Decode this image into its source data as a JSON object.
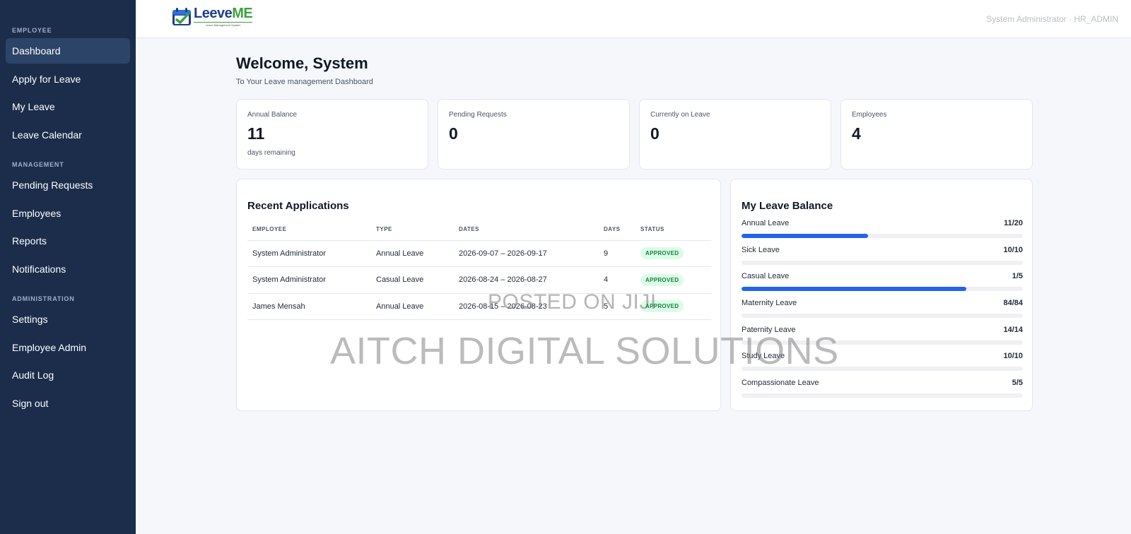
{
  "sidebar": {
    "sections": [
      {
        "title": "EMPLOYEE",
        "items": [
          "Dashboard",
          "Apply for Leave",
          "My Leave",
          "Leave Calendar"
        ]
      },
      {
        "title": "MANAGEMENT",
        "items": [
          "Pending Requests",
          "Employees",
          "Reports",
          "Notifications"
        ]
      },
      {
        "title": "ADMINISTRATION",
        "items": [
          "Settings",
          "Employee Admin",
          "Audit Log",
          "Sign out"
        ]
      }
    ],
    "active": "Dashboard"
  },
  "header": {
    "logo_part1": "Leeve",
    "logo_part2": "ME",
    "logo_tagline": "Leave Management System",
    "user": "System Administrator · HR_ADMIN"
  },
  "main": {
    "welcome": "Welcome, System",
    "subtitle": "To Your Leave management Dashboard",
    "stats": [
      {
        "label": "Annual Balance",
        "value": "11",
        "note": "days remaining"
      },
      {
        "label": "Pending Requests",
        "value": "0",
        "note": ""
      },
      {
        "label": "Currently on Leave",
        "value": "0",
        "note": ""
      },
      {
        "label": "Employees",
        "value": "4",
        "note": ""
      }
    ],
    "recent": {
      "title": "Recent Applications",
      "columns": [
        "EMPLOYEE",
        "TYPE",
        "DATES",
        "DAYS",
        "STATUS"
      ],
      "rows": [
        {
          "employee": "System Administrator",
          "type": "Annual Leave",
          "dates": "2026-09-07 – 2026-09-17",
          "days": "9",
          "status": "APPROVED"
        },
        {
          "employee": "System Administrator",
          "type": "Casual Leave",
          "dates": "2026-08-24 – 2026-08-27",
          "days": "4",
          "status": "APPROVED"
        },
        {
          "employee": "James Mensah",
          "type": "Annual Leave",
          "dates": "2026-08-15 – 2026-08-23",
          "days": "5",
          "status": "APPROVED"
        }
      ]
    },
    "balance": {
      "title": "My Leave Balance",
      "items": [
        {
          "name": "Annual Leave",
          "fraction": "11/20",
          "fill": 0.45
        },
        {
          "name": "Sick Leave",
          "fraction": "10/10",
          "fill": 0
        },
        {
          "name": "Casual Leave",
          "fraction": "1/5",
          "fill": 0.8
        },
        {
          "name": "Maternity Leave",
          "fraction": "84/84",
          "fill": 0
        },
        {
          "name": "Paternity Leave",
          "fraction": "14/14",
          "fill": 0
        },
        {
          "name": "Study Leave",
          "fraction": "10/10",
          "fill": 0
        },
        {
          "name": "Compassionate Leave",
          "fraction": "5/5",
          "fill": 0
        }
      ]
    }
  },
  "watermark": {
    "line1": "POSTED ON JIJI",
    "line2": "AITCH DIGITAL SOLUTIONS"
  },
  "colors": {
    "sidebar_bg": "#1b2d4b",
    "accent": "#2563eb",
    "approved_bg": "#dcfce7",
    "approved_text": "#15803d"
  }
}
